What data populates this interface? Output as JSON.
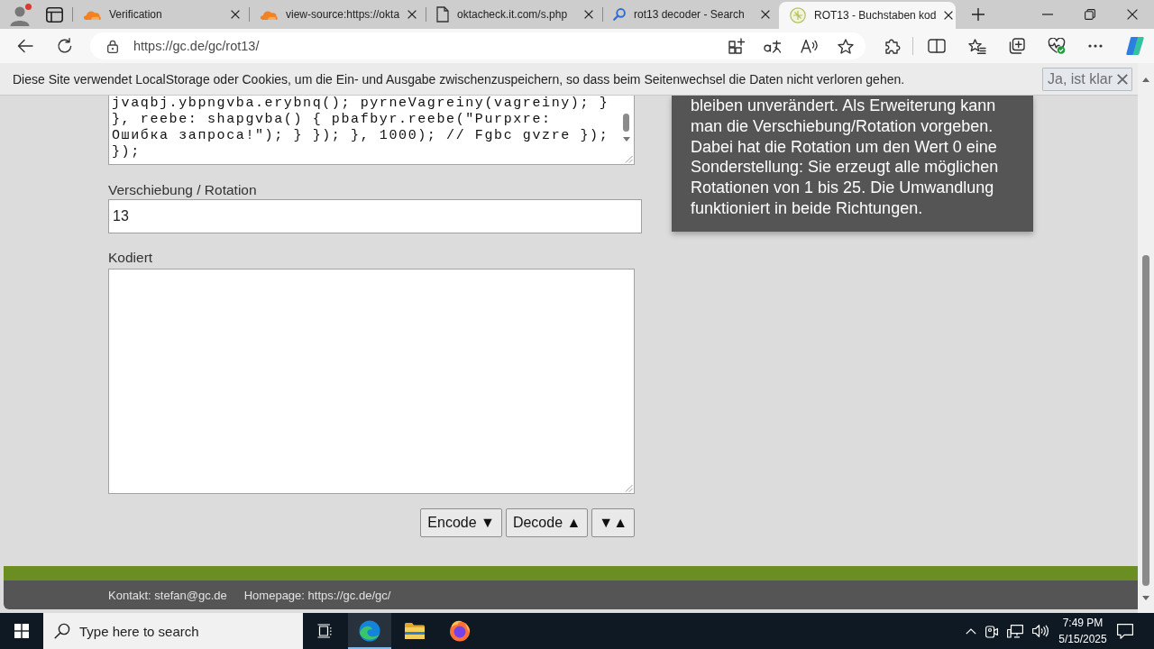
{
  "browser": {
    "tabs": [
      {
        "kind": "cloud",
        "title": "Verification",
        "selected": false
      },
      {
        "kind": "cloud",
        "title": "view-source:https://okta",
        "selected": false
      },
      {
        "kind": "page",
        "title": "oktacheck.it.com/s.php",
        "selected": false
      },
      {
        "kind": "search",
        "title": "rot13 decoder - Search",
        "selected": false
      },
      {
        "kind": "site",
        "title": "ROT13 - Buchstaben kod",
        "selected": true
      }
    ],
    "address": "https://gc.de/gc/rot13/"
  },
  "cookie_notice": {
    "text": "Diese Site verwendet LocalStorage oder Cookies, um die Ein- und Ausgabe zwischenzuspeichern, so dass beim Seitenwechsel die Daten nicht verloren gehen.",
    "button": "Ja, ist klar"
  },
  "converter": {
    "input_text": "jvaqbj.ybpngvba.erybnq(); pyrneVagreiny(vagreiny); } }, reebe: shapgvba() { pbafbyr.reebe(\"Purpxre: Ошибка запроса!\"); } }); }, 1000); // Fgbc gvzre }); });",
    "rotation_label": "Verschiebung / Rotation",
    "rotation_value": "13",
    "output_label": "Kodiert",
    "buttons": [
      {
        "label": "Encode ▼"
      },
      {
        "label": "Decode ▲"
      },
      {
        "label": "▼▲"
      }
    ]
  },
  "info_panel": {
    "text": "bleiben unverändert. Als Erweiterung kann man die Verschiebung/Rotation vorgeben. Dabei hat die Rotation um den Wert 0 eine Sonderstellung: Sie erzeugt alle möglichen Rotationen von 1 bis 25. Die Umwandlung funktioniert in beide Richtungen."
  },
  "footer": {
    "contact": "Kontakt: stefan@gc.de",
    "homepage": "Homepage: https://gc.de/gc/"
  },
  "taskbar": {
    "search_placeholder": "Type here to search",
    "apps": [
      {
        "kind": "swirl",
        "selected": true
      },
      {
        "kind": "folder",
        "selected": false
      },
      {
        "kind": "fox",
        "selected": false
      }
    ],
    "time": "7:49 PM",
    "date": "5/15/2025"
  }
}
